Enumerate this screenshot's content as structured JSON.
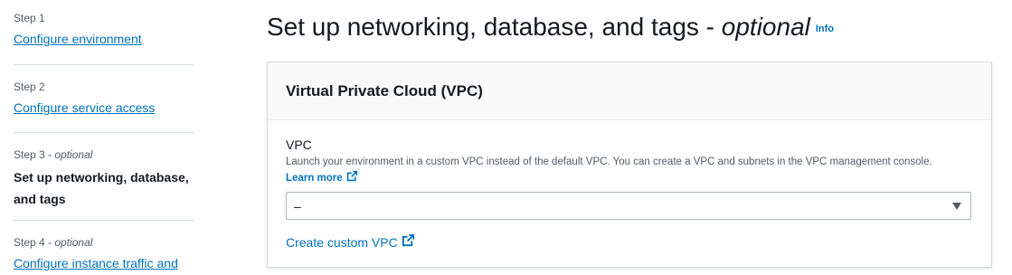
{
  "steps": [
    {
      "number": "Step 1",
      "optional": "",
      "label": "Configure environment"
    },
    {
      "number": "Step 2",
      "optional": "",
      "label": "Configure service access"
    },
    {
      "number": "Step 3",
      "optional": " - optional",
      "label_line1": "Set up networking, database,",
      "label_line2": "and tags"
    },
    {
      "number": "Step 4",
      "optional": " - optional",
      "label": "Configure instance traffic and"
    }
  ],
  "page": {
    "title": "Set up networking, database, and tags - ",
    "title_optional": "optional",
    "info_label": "Info"
  },
  "vpc_panel": {
    "title": "Virtual Private Cloud (VPC)",
    "field_label": "VPC",
    "description": "Launch your environment in a custom VPC instead of the default VPC. You can create a VPC and subnets in the VPC management console.",
    "learn_more_label": "Learn more",
    "select_value": "–",
    "create_link_label": "Create custom VPC"
  },
  "colors": {
    "link": "#0073bb",
    "text": "#16191f",
    "muted": "#545b64",
    "border": "#d5dbdb"
  },
  "icons": {
    "external": "external-link-icon",
    "caret": "caret-down-icon"
  }
}
